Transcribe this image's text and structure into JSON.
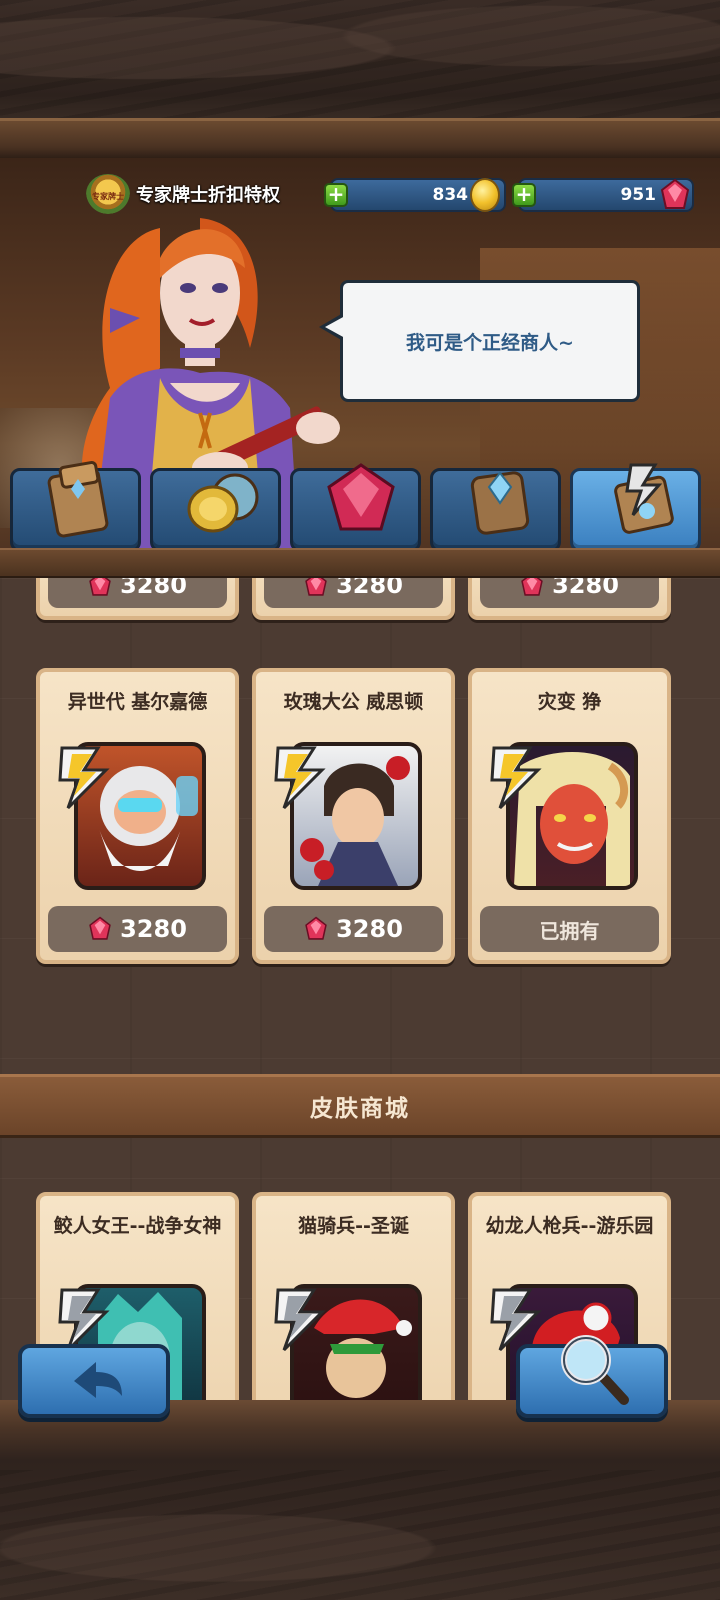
{
  "header": {
    "vip_badge_text": "专家牌士",
    "vip_title": "专家牌士折扣特权",
    "gold": "834",
    "gems": "951"
  },
  "merchant": {
    "speech": "我可是个正经商人~"
  },
  "tabs": [
    {
      "icon": "card-pack-icon",
      "active": false
    },
    {
      "icon": "gold-coin-pouch-icon",
      "active": false
    },
    {
      "icon": "ruby-gem-icon",
      "active": false
    },
    {
      "icon": "crystal-book-icon",
      "active": false
    },
    {
      "icon": "hero-skin-card-icon",
      "active": true
    }
  ],
  "hero_shop": {
    "partial_row_prices": [
      "3280",
      "3280",
      "3280"
    ],
    "items": [
      {
        "name": "异世代 基尔嘉德",
        "price": "3280",
        "owned": false
      },
      {
        "name": "玫瑰大公 威思顿",
        "price": "3280",
        "owned": false
      },
      {
        "name": "灾变 狰",
        "status": "已拥有",
        "owned": true
      }
    ]
  },
  "skin_shop": {
    "title": "皮肤商城",
    "items": [
      {
        "name": "鲛人女王--战争女神"
      },
      {
        "name": "猫骑兵--圣诞"
      },
      {
        "name": "幼龙人枪兵--游乐园"
      }
    ]
  },
  "buttons": {
    "back_icon": "back-arrow-icon",
    "search_icon": "magnifier-icon"
  },
  "colors": {
    "gem": "#e0345a",
    "tab_blue": "#2e6fb0",
    "card_bg": "#f6e4c7",
    "price_bg": "#7a6a5e"
  }
}
